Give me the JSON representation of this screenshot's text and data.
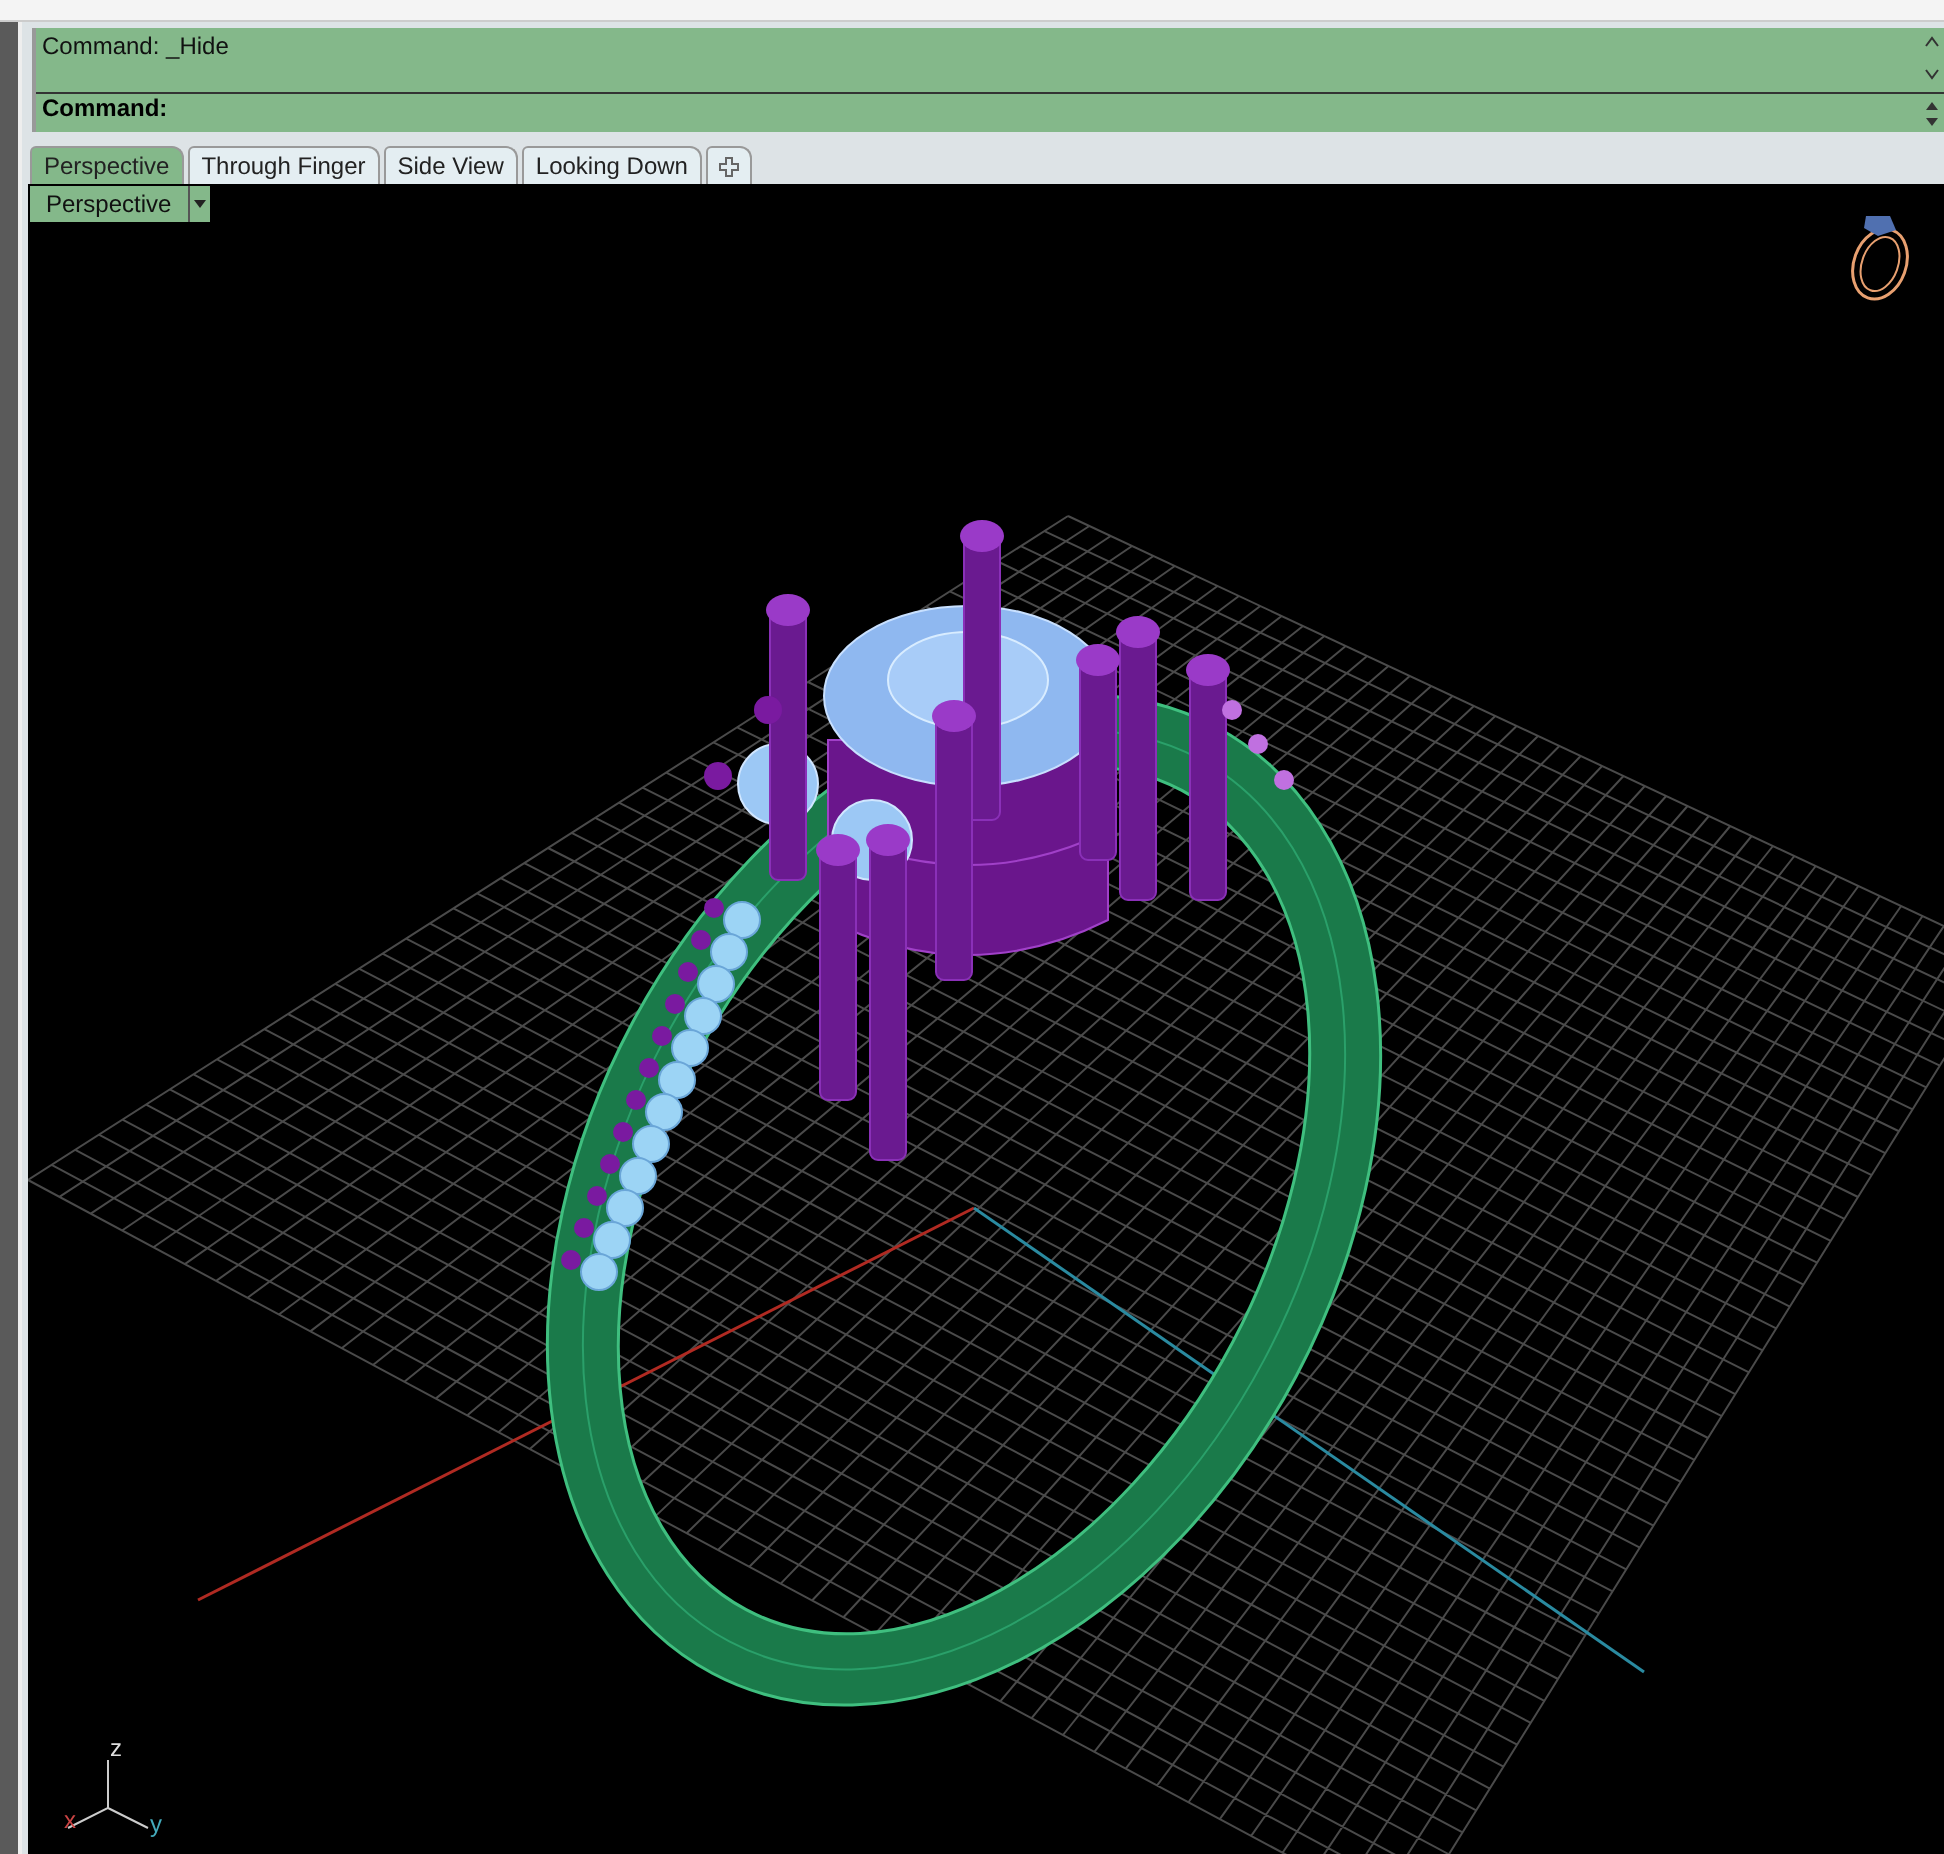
{
  "command_area": {
    "history": [
      "Command: _Hide"
    ],
    "prompt": "Command:"
  },
  "tabs": [
    {
      "label": "Perspective",
      "selected": true
    },
    {
      "label": "Through Finger",
      "selected": false
    },
    {
      "label": "Side View",
      "selected": false
    },
    {
      "label": "Looking Down",
      "selected": false
    }
  ],
  "viewport": {
    "title": "Perspective",
    "axis_labels": {
      "z": "z",
      "x": "x",
      "y": "y"
    }
  }
}
